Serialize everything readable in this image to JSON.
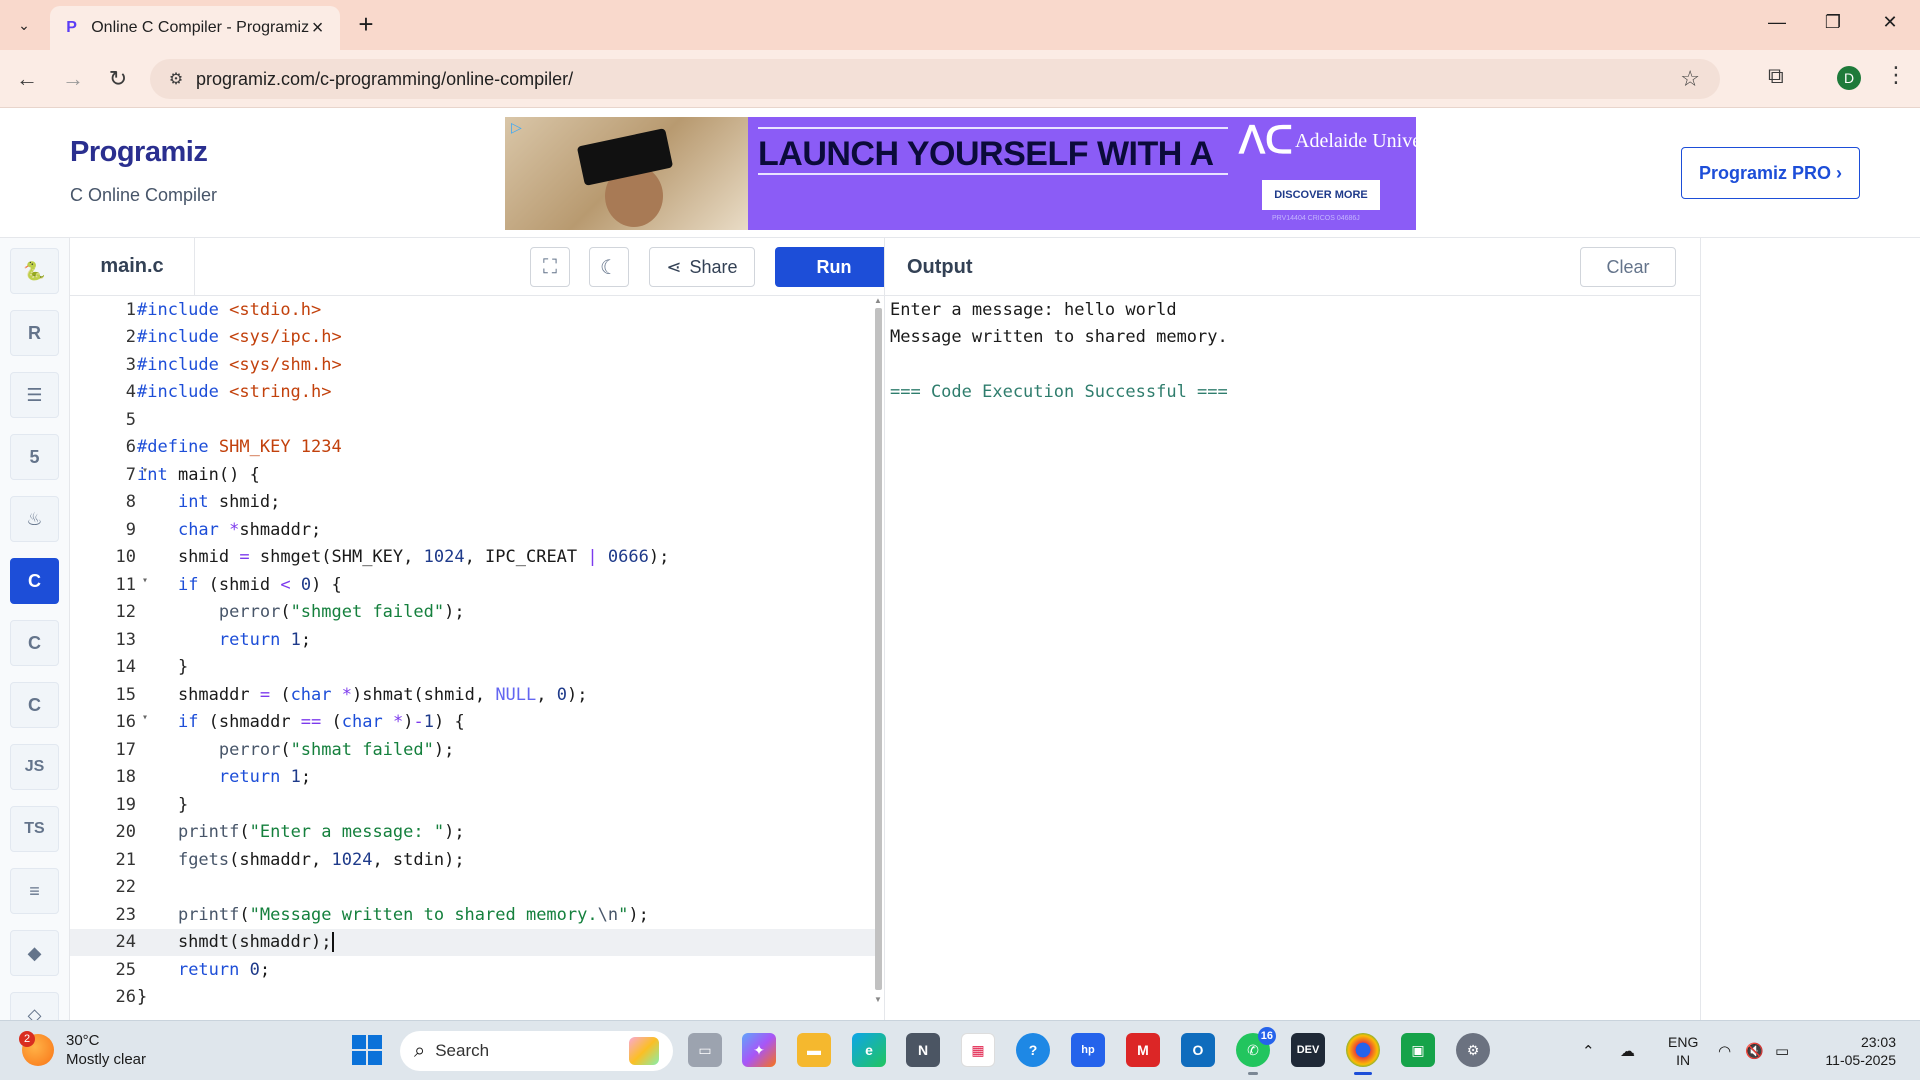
{
  "browser": {
    "tab_title": "Online C Compiler - Programiz",
    "url": "programiz.com/c-programming/online-compiler/",
    "profile_initial": "D"
  },
  "site": {
    "logo": "Programiz",
    "subtitle": "C Online Compiler",
    "pro_button": "Programiz PRO ›",
    "ad": {
      "headline": "LAUNCH YOURSELF WITH A",
      "university": "Adelaide University",
      "button": "DISCOVER MORE",
      "fine_print": "PRV14404 CRICOS 04686J"
    }
  },
  "rail": {
    "items": [
      {
        "name": "python",
        "glyph": "🐍"
      },
      {
        "name": "r",
        "glyph": "R"
      },
      {
        "name": "sql",
        "glyph": "☰"
      },
      {
        "name": "html",
        "glyph": "5"
      },
      {
        "name": "java",
        "glyph": "♨"
      },
      {
        "name": "c",
        "glyph": "C"
      },
      {
        "name": "cpp",
        "glyph": "C"
      },
      {
        "name": "csharp",
        "glyph": "C"
      },
      {
        "name": "js",
        "glyph": "JS"
      },
      {
        "name": "ts",
        "glyph": "TS"
      },
      {
        "name": "go",
        "glyph": "≡"
      },
      {
        "name": "swift",
        "glyph": "◆"
      },
      {
        "name": "more",
        "glyph": "◇"
      }
    ]
  },
  "editor": {
    "filename": "main.c",
    "share_label": "Share",
    "run_label": "Run"
  },
  "output": {
    "title": "Output",
    "clear_label": "Clear",
    "lines": [
      "Enter a message: hello world",
      "Message written to shared memory.",
      "",
      "=== Code Execution Successful ==="
    ]
  },
  "taskbar": {
    "temperature": "30°C",
    "weather": "Mostly clear",
    "weather_badge": "2",
    "search_placeholder": "Search",
    "whatsapp_badge": "16",
    "lang_top": "ENG",
    "lang_bottom": "IN",
    "time": "23:03",
    "date": "11-05-2025"
  },
  "colors": {
    "accent": "#1d4ed8",
    "tabbar": "#f9d9cc",
    "success": "#2f7d6d"
  }
}
